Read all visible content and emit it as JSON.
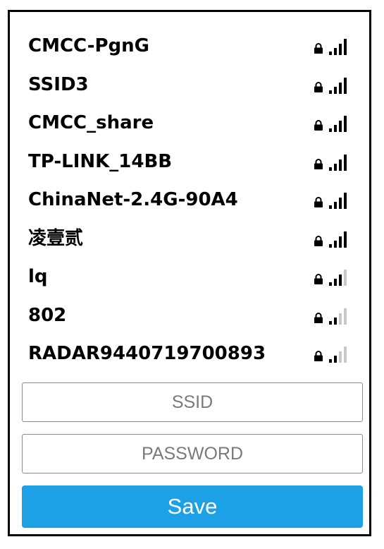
{
  "networks": [
    {
      "ssid": "CMCC-PgnG",
      "secured": true,
      "signal": 4
    },
    {
      "ssid": "SSID3",
      "secured": true,
      "signal": 4
    },
    {
      "ssid": "CMCC_share",
      "secured": true,
      "signal": 4
    },
    {
      "ssid": "TP-LINK_14BB",
      "secured": true,
      "signal": 4
    },
    {
      "ssid": "ChinaNet-2.4G-90A4",
      "secured": true,
      "signal": 4
    },
    {
      "ssid": "凌壹贰",
      "secured": true,
      "signal": 4
    },
    {
      "ssid": "lq",
      "secured": true,
      "signal": 3
    },
    {
      "ssid": "802",
      "secured": true,
      "signal": 2
    },
    {
      "ssid": "RADAR9440719700893",
      "secured": true,
      "signal": 2
    }
  ],
  "form": {
    "ssid_placeholder": "SSID",
    "ssid_value": "",
    "password_placeholder": "PASSWORD",
    "password_value": "",
    "save_label": "Save"
  },
  "colors": {
    "accent": "#1da1e6",
    "signal_active": "#000000",
    "signal_inactive": "#c8c8c8",
    "text": "#000000",
    "border": "#000000"
  },
  "icons": {
    "lock": "lock-icon",
    "signal": "wifi-signal-icon"
  }
}
